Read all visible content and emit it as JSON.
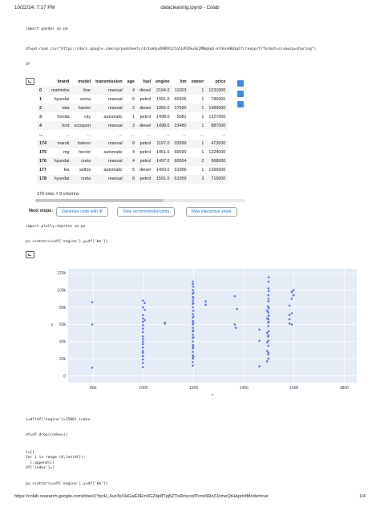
{
  "browser": {
    "timestamp": "10/22/24, 7:17 PM",
    "title": "datacleaning.ipynb - Colab",
    "url": "https://colab.research.google.com/drive/1YpcH_4uz3sVHGwE9Em0GZ4p8Tjq5ZTxR#scrollTo=e9RzZJomeQtH&printMode=true",
    "page": "1/4"
  },
  "cells": {
    "c1": "import pandas as pd",
    "c2": "df=pd.read_csv(\"https://docs.google.com/spreadsheets/d/1okbudhRRXIz5a5LPC8SuSE2MBgkpQ-kY4nnAB83gCfc/export?format=csv&usp=sharing\")",
    "c3": "df",
    "c4": "import plotly.express as px",
    "c5": "px.scatter(x=df['engine'],y=df['km'])",
    "c6": "i=df[df['engine']>1500].index",
    "c7": "df=df.drop(index=i)",
    "c8": "l=[]\nfor i in range (0,len(df)):\n  l.append(i)\ndf['index']=l",
    "c9": "px.scatter(x=df['engine'],y=df['km'])"
  },
  "dataframe": {
    "columns": [
      "",
      "brand",
      "model",
      "transmission",
      "age",
      "fuel",
      "engine",
      "km",
      "owner",
      "price"
    ],
    "rows": [
      [
        "0",
        "mahindra",
        "thar",
        "manual",
        "4",
        "diesel",
        "2184.0",
        "11003",
        "1",
        "1231000"
      ],
      [
        "1",
        "hyundai",
        "verna",
        "manual",
        "6",
        "petrol",
        "1591.0",
        "66936",
        "1",
        "786000"
      ],
      [
        "2",
        "tata",
        "harrier",
        "manual",
        "2",
        "diesel",
        "1956.0",
        "27990",
        "1",
        "1489000"
      ],
      [
        "3",
        "honda",
        "city",
        "automatic",
        "1",
        "petrol",
        "1498.0",
        "5081",
        "1",
        "1227000"
      ],
      [
        "4",
        "ford",
        "ecosport",
        "manual",
        "3",
        "diesel",
        "1498.0",
        "23480",
        "1",
        "887000"
      ],
      [
        "...",
        "...",
        "...",
        "...",
        "...",
        "...",
        "...",
        "...",
        "...",
        "..."
      ],
      [
        "174",
        "maruti",
        "baleno",
        "manual",
        "8",
        "petrol",
        "1197.0",
        "33099",
        "1",
        "473000"
      ],
      [
        "175",
        "mg",
        "hector",
        "automatic",
        "4",
        "petrol",
        "1451.0",
        "66590",
        "1",
        "1224000"
      ],
      [
        "176",
        "hyundai",
        "creta",
        "manual",
        "4",
        "petrol",
        "1497.0",
        "60554",
        "2",
        "968000"
      ],
      [
        "177",
        "kia",
        "seltos",
        "automatic",
        "5",
        "diesel",
        "1493.0",
        "51956",
        "1",
        "1266000"
      ],
      [
        "178",
        "hyundai",
        "creta",
        "manual",
        "8",
        "petrol",
        "1591.0",
        "61059",
        "3",
        "715000"
      ]
    ],
    "info": "179 rows × 9 columns"
  },
  "next_steps": {
    "label": "Next steps:",
    "b1": "Generate code with df",
    "b2": "View recommended plots",
    "b3": "New interactive sheet"
  },
  "chart_data": {
    "type": "scatter",
    "xlabel": "x",
    "ylabel": "y",
    "xlim": [
      700,
      1850
    ],
    "ylim": [
      -8000,
      125000
    ],
    "xticks": [
      800,
      1000,
      1200,
      1400,
      1600,
      1800
    ],
    "yticks": [
      0,
      20000,
      40000,
      60000,
      80000,
      100000,
      120000
    ],
    "ytick_labels": [
      "0",
      "20k",
      "40k",
      "60k",
      "80k",
      "100k",
      "120k"
    ],
    "point_color": "#636efa",
    "x": [
      796,
      796,
      796,
      998,
      998,
      998,
      998,
      998,
      998,
      998,
      998,
      998,
      998,
      998,
      998,
      998,
      998,
      998,
      998,
      998,
      998,
      998,
      1005,
      1005,
      1005,
      1086,
      1086,
      1197,
      1197,
      1197,
      1197,
      1197,
      1197,
      1197,
      1197,
      1197,
      1197,
      1197,
      1197,
      1197,
      1197,
      1197,
      1197,
      1197,
      1197,
      1197,
      1197,
      1197,
      1197,
      1197,
      1197,
      1199,
      1199,
      1199,
      1199,
      1199,
      1199,
      1199,
      1199,
      1199,
      1199,
      1199,
      1248,
      1248,
      1364,
      1364,
      1368,
      1373,
      1462,
      1462,
      1462,
      1493,
      1493,
      1493,
      1493,
      1493,
      1493,
      1497,
      1497,
      1497,
      1497,
      1498,
      1498,
      1498,
      1498,
      1498,
      1498,
      1498,
      1498,
      1498,
      1498,
      1498,
      1498,
      1499,
      1499,
      1499,
      1499,
      1499,
      1499,
      1499,
      1582,
      1582,
      1582,
      1582,
      1591,
      1591,
      1591,
      1591,
      1598,
      1598
    ],
    "y": [
      86000,
      60000,
      9500,
      88000,
      80000,
      71000,
      67000,
      63000,
      59000,
      55000,
      51000,
      46000,
      43000,
      40000,
      37000,
      33000,
      29000,
      27000,
      23000,
      19000,
      15000,
      10000,
      85000,
      77000,
      65000,
      62000,
      61000,
      110000,
      107000,
      100000,
      96000,
      92000,
      88000,
      84000,
      80000,
      72000,
      68000,
      64000,
      60000,
      56000,
      52000,
      48000,
      44000,
      40000,
      36000,
      32000,
      28000,
      24000,
      20000,
      16000,
      12000,
      104000,
      97000,
      91000,
      85000,
      76000,
      69000,
      62000,
      53000,
      45000,
      34000,
      22000,
      87000,
      83000,
      93000,
      60000,
      56000,
      78000,
      54000,
      41000,
      11000,
      76000,
      67000,
      50000,
      39000,
      29000,
      17000,
      81000,
      62000,
      46000,
      25000,
      110000,
      102000,
      94000,
      87000,
      74000,
      66000,
      58000,
      47000,
      41000,
      35000,
      27000,
      20000,
      115000,
      99000,
      90000,
      79000,
      70000,
      63000,
      52000,
      82000,
      71000,
      66000,
      61000,
      98000,
      90000,
      73000,
      60000,
      100000,
      94000
    ]
  }
}
